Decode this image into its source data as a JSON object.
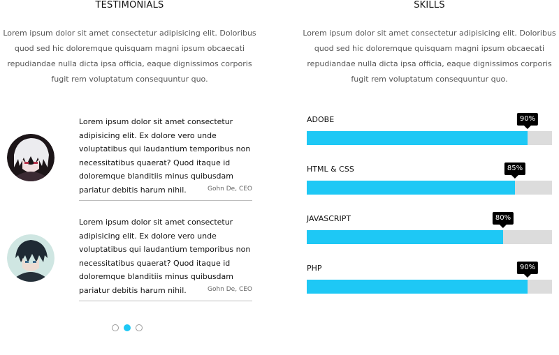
{
  "testimonials": {
    "title": "TESTIMONIALS",
    "intro": "Lorem ipsum dolor sit amet consectetur adipisicing elit. Doloribus quod sed hic doloremque quisquam magni ipsum obcaecati repudiandae nulla dicta ipsa officia, eaque dignissimos corporis fugit rem voluptatum consequuntur quo.",
    "items": [
      {
        "quote": "Lorem ipsum dolor sit amet consectetur adipisicing elit. Ex dolore vero unde voluptatibus qui laudantium temporibus non necessitatibus quaerat? Quod itaque id doloremque blanditiis minus quibusdam pariatur debitis harum nihil.",
        "author": "Gohn De, CEO"
      },
      {
        "quote": "Lorem ipsum dolor sit amet consectetur adipisicing elit. Ex dolore vero unde voluptatibus qui laudantium temporibus non necessitatibus quaerat? Quod itaque id doloremque blanditiis minus quibusdam pariatur debitis harum nihil.",
        "author": "Gohn De, CEO"
      }
    ],
    "pagination": {
      "count": 3,
      "active_index": 1
    }
  },
  "skills": {
    "title": "SKILLS",
    "intro": "Lorem ipsum dolor sit amet consectetur adipisicing elit. Doloribus quod sed hic doloremque quisquam magni ipsum obcaecati repudiandae nulla dicta ipsa officia, eaque dignissimos corporis fugit rem voluptatum consequuntur quo.",
    "items": [
      {
        "name": "ADOBE",
        "percent_label": "90%",
        "value": 90
      },
      {
        "name": "HTML & CSS",
        "percent_label": "85%",
        "value": 85
      },
      {
        "name": "JAVASCRIPT",
        "percent_label": "80%",
        "value": 80
      },
      {
        "name": "PHP",
        "percent_label": "90%",
        "value": 90
      }
    ]
  },
  "colors": {
    "accent": "#1ec8f5",
    "track": "#dcdcdc",
    "badge": "#000000"
  }
}
